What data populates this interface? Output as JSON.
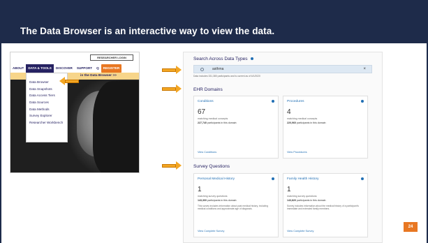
{
  "slide": {
    "title": "The Data Browser is an interactive way to view the data.",
    "page_number": "24"
  },
  "colors": {
    "title_bar": "#1e2b4a",
    "arrow": "#f3a623",
    "nav_active": "#262262",
    "register": "#e87722",
    "banner": "#f7d58a",
    "link": "#216fb4"
  },
  "site": {
    "researcher_login": "RESEARCHER LOGIN",
    "nav": {
      "about": "ABOUT",
      "data_tools": "DATA & TOOLS",
      "discover": "DISCOVER",
      "support": "SUPPORT",
      "search_icon": "Q",
      "register": "REGISTER"
    },
    "banner": "in the Data Browser >>",
    "dropdown": [
      "Data Browser",
      "Data Snapshots",
      "Data Access Tiers",
      "Data Sources",
      "Data Methods",
      "Survey Explorer",
      "Researcher Workbench"
    ]
  },
  "browser": {
    "search_title": "Search Across Data Types",
    "search_value": "asthma",
    "clear_icon": "×",
    "search_note": "Data includes 331,380 participants and is current as of 6/1/2020",
    "ehr_title": "EHR Domains",
    "survey_title": "Survey Questions",
    "cards": {
      "conditions": {
        "title": "Conditions",
        "count": "67",
        "sub": "matching medical concepts",
        "people_num": "227,740",
        "people_rest": "participants in this domain",
        "link": "View Conditions"
      },
      "procedures": {
        "title": "Procedures",
        "count": "4",
        "sub": "matching medical concepts",
        "people_num": "220,960",
        "people_rest": "participants in this domain",
        "link": "View Procedures"
      },
      "personal_medical": {
        "title": "Personal Medical History",
        "count": "1",
        "sub": "matching survey questions",
        "people_num": "143,300",
        "people_rest": "participants in this domain",
        "desc": "This survey includes information about past medical history, including medical conditions and approximate age of diagnosis.",
        "link": "View Complete Survey"
      },
      "family_health": {
        "title": "Family Health History",
        "count": "1",
        "sub": "matching survey questions",
        "people_num": "143,820",
        "people_rest": "participants in this domain",
        "desc": "Survey includes information about the medical history of a participant's immediate and extended family members.",
        "link": "View Complete Survey"
      }
    }
  },
  "icons": [
    "search-icon",
    "info-icon",
    "close-icon",
    "arrow-right-icon",
    "arrow-left-icon"
  ]
}
